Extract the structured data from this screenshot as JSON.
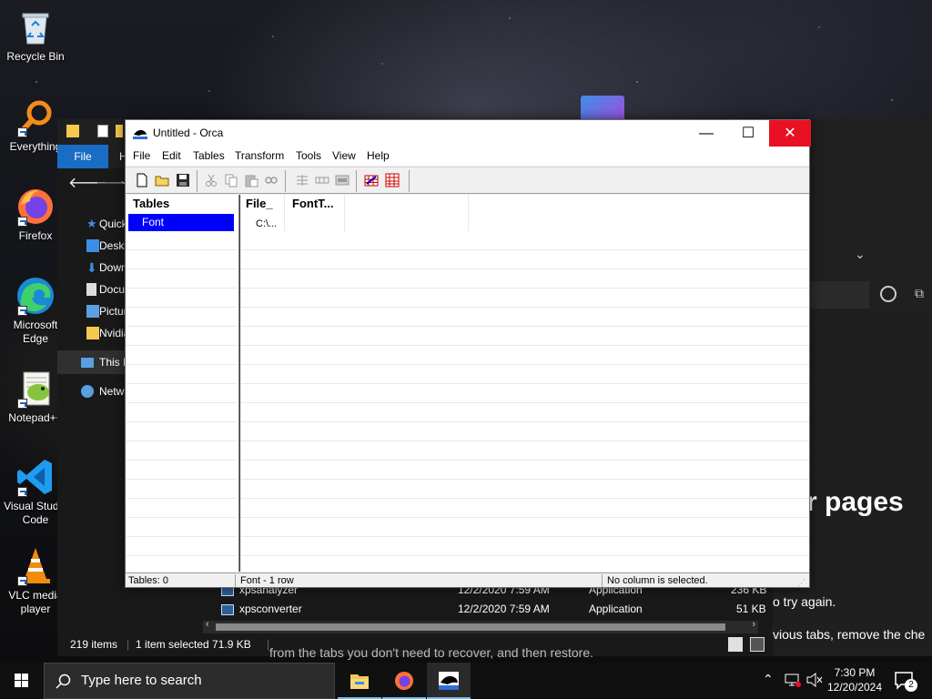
{
  "desktop": {
    "icons": [
      {
        "label": "Recycle Bin"
      },
      {
        "label": "Everything"
      },
      {
        "label": "Firefox"
      },
      {
        "label": "Microsoft Edge"
      },
      {
        "label": "Notepad++"
      },
      {
        "label": "Visual Studio Code"
      },
      {
        "label": "VLC media player"
      }
    ]
  },
  "explorer": {
    "file_tab": "File",
    "nav": [
      "Quick access",
      "Desktop",
      "Downloads",
      "Documents",
      "Pictures",
      "Nvidia",
      "This PC",
      "Network"
    ],
    "files": [
      {
        "name": "xpsanalyzer",
        "date": "12/2/2020 7:59 AM",
        "type": "Application",
        "size": "236 KB"
      },
      {
        "name": "xpsconverter",
        "date": "12/2/2020 7:59 AM",
        "type": "Application",
        "size": "51 KB"
      }
    ],
    "status": {
      "items": "219 items",
      "selected": "1 item selected  71.9 KB"
    }
  },
  "background_page": {
    "heading_fragment": "r pages",
    "line1_fragment": "o try again.",
    "line2_fragment": "vious tabs, remove the che",
    "line3_fragment": "from the tabs you don't need to recover, and then restore."
  },
  "orca": {
    "title": "Untitled - Orca",
    "menu": [
      "File",
      "Edit",
      "Tables",
      "Transform",
      "Tools",
      "View",
      "Help"
    ],
    "tables_header": "Tables",
    "tables": [
      "Font"
    ],
    "selected_table": "Font",
    "columns": [
      "File_",
      "FontT..."
    ],
    "rows": [
      [
        "C:\\...",
        ""
      ]
    ],
    "status": {
      "tables": "Tables: 0",
      "rows": "Font - 1 row",
      "column": "No column is selected."
    }
  },
  "taskbar": {
    "search_placeholder": "Type here to search",
    "time": "7:30 PM",
    "date": "12/20/2024",
    "notification_count": "2"
  },
  "colors": {
    "selection": "#0000ff",
    "close_button": "#e81123",
    "explorer_accent": "#1a6dc4"
  }
}
